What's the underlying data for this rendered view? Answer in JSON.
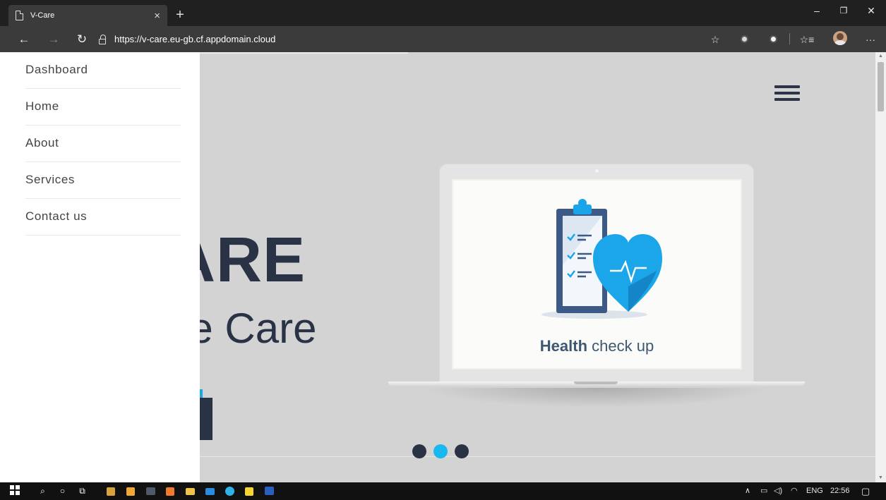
{
  "browser": {
    "tab_title": "V-Care",
    "tab_close": "×",
    "new_tab": "+",
    "url": "https://v-care.eu-gb.cf.appdomain.cloud",
    "win_minimize": "–",
    "win_restore": "❐",
    "win_close": "✕"
  },
  "sidebar": {
    "items": [
      {
        "label": "Dashboard"
      },
      {
        "label": "Home"
      },
      {
        "label": "About"
      },
      {
        "label": "Services"
      },
      {
        "label": "Contact us"
      }
    ]
  },
  "hero": {
    "title_visible": "ARE",
    "subtitle_visible": "ake Care",
    "screen_caption_bold": "Health",
    "screen_caption_rest": " check up",
    "slides": 3,
    "active_slide": 2
  },
  "taskbar": {
    "language": "ENG",
    "time": "22:56"
  },
  "colors": {
    "accent": "#17b9ef",
    "dark": "#2a3346",
    "heart": "#1ca6ea"
  }
}
